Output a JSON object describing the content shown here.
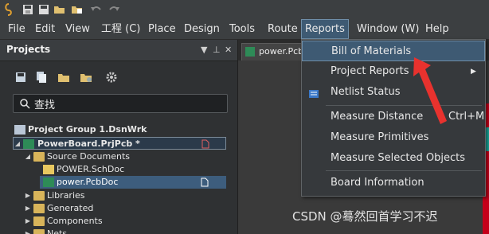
{
  "menubar": {
    "items": [
      "File",
      "Edit",
      "View",
      "工程 (C)",
      "Place",
      "Design",
      "Tools",
      "Route",
      "Reports",
      "Window (W)",
      "Help"
    ]
  },
  "projects_panel": {
    "title": "Projects",
    "search_text": "查找",
    "tree": {
      "group": "Project Group 1.DsnWrk",
      "project": "PowerBoard.PrjPcb *",
      "source_documents": "Source Documents",
      "schdoc": "POWER.SchDoc",
      "pcbdoc": "power.PcbDoc",
      "libraries": "Libraries",
      "generated": "Generated",
      "components": "Components",
      "nets": "Nets"
    }
  },
  "document_tab": {
    "label": "power.Pcb"
  },
  "reports_menu": {
    "items": [
      {
        "label": "Bill of Materials",
        "highlighted": true
      },
      {
        "label": "Project Reports",
        "submenu": true
      },
      {
        "label": "Netlist Status"
      },
      {
        "label": "Measure Distance",
        "shortcut": "Ctrl+M"
      },
      {
        "label": "Measure Primitives"
      },
      {
        "label": "Measure Selected Objects"
      },
      {
        "label": "Board Information"
      }
    ]
  },
  "watermark": "CSDN @蓦然回首学习不迟",
  "colors": {
    "menu_highlight": "#3e5a73",
    "annotation_arrow": "#e8322e",
    "selection_row": "#3d5d7d"
  }
}
